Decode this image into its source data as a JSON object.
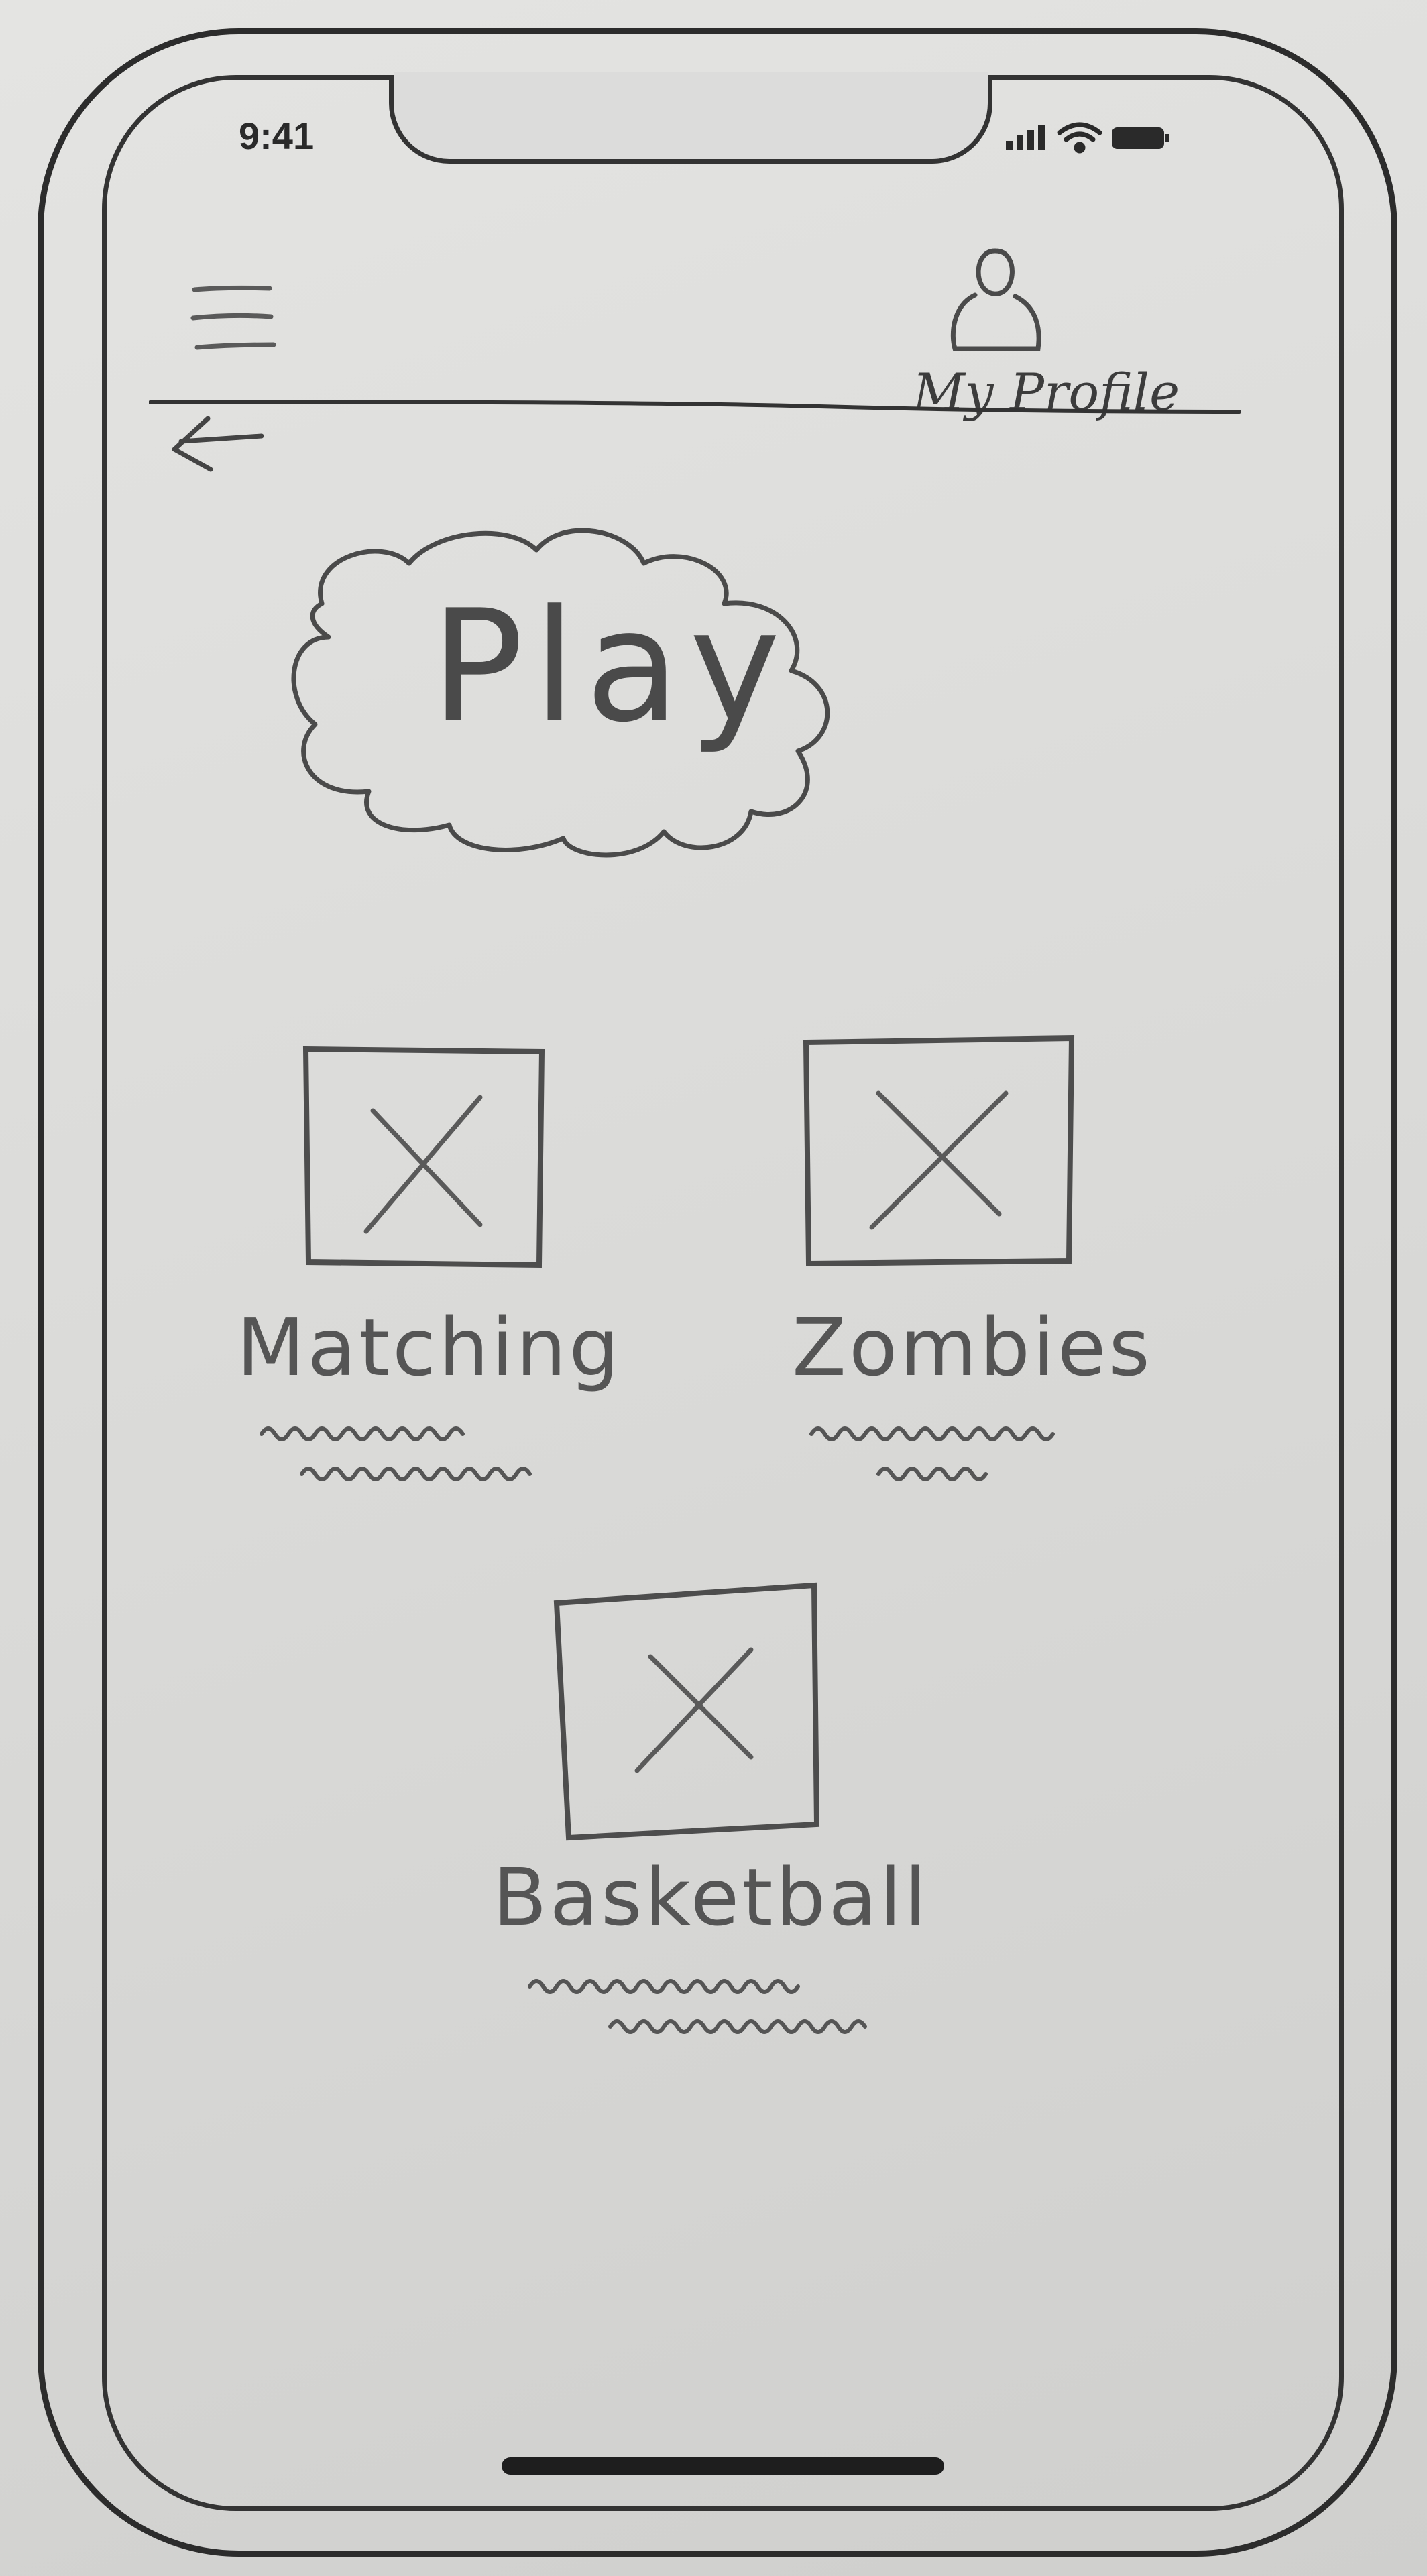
{
  "status_bar": {
    "time": "9:41",
    "icons": [
      "signal-icon",
      "wifi-icon",
      "battery-icon"
    ]
  },
  "header": {
    "menu_icon": "hamburger-menu-icon",
    "profile_icon": "user-icon",
    "profile_label": "My Profile",
    "back_icon": "back-arrow-icon"
  },
  "main": {
    "title": "Play",
    "games": [
      {
        "label": "Matching",
        "image": "image-placeholder-icon"
      },
      {
        "label": "Zombies",
        "image": "image-placeholder-icon"
      },
      {
        "label": "Basketball",
        "image": "image-placeholder-icon"
      }
    ]
  },
  "colors": {
    "paper": "#dcdcdb",
    "ink": "#2c2c2c",
    "pencil": "#4d4d4d"
  }
}
